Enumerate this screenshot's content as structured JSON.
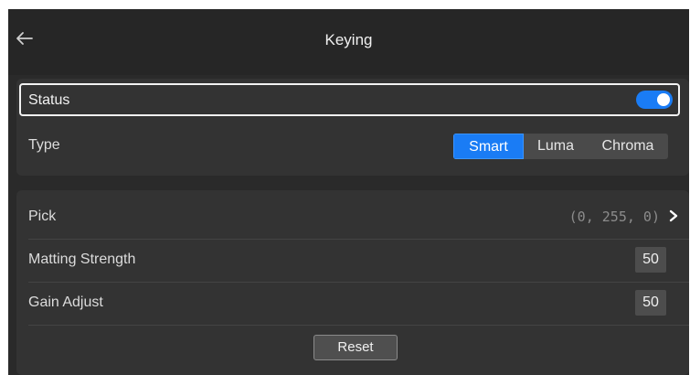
{
  "header": {
    "title": "Keying",
    "back_icon": "arrow-left-icon"
  },
  "status": {
    "label": "Status",
    "toggle_on": true,
    "accent_color": "#1a7cf5"
  },
  "type": {
    "label": "Type",
    "options": [
      "Smart",
      "Luma",
      "Chroma"
    ],
    "selected": "Smart"
  },
  "pick": {
    "label": "Pick",
    "value": "(0, 255, 0)",
    "chevron_icon": "chevron-right-icon"
  },
  "matting_strength": {
    "label": "Matting Strength",
    "value": "50"
  },
  "gain_adjust": {
    "label": "Gain Adjust",
    "value": "50"
  },
  "reset": {
    "label": "Reset"
  }
}
